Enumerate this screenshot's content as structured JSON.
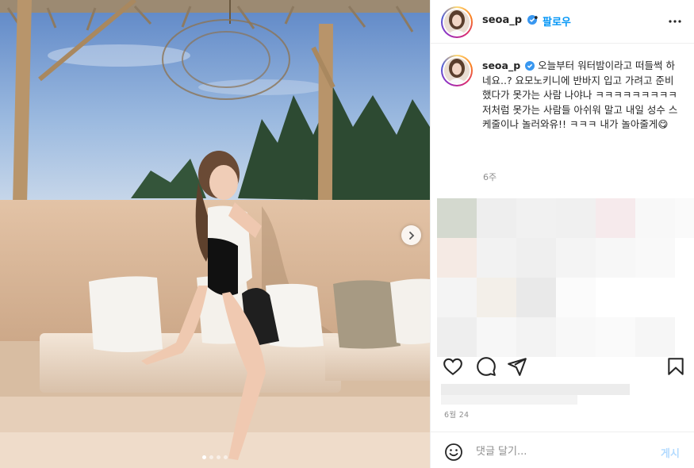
{
  "post": {
    "username": "seoa_p",
    "verified": true,
    "separator": "•",
    "follow_label": "팔로우",
    "caption_text": "오늘부터 워터밤이라고 떠들썩 하네요..? 요모노키니에 반바지 입고 가려고 준비했다가 못가는 사람 나야나 ㅋㅋㅋㅋㅋㅋㅋㅋㅋ 저처럼 못가는 사람들 아쉬워 말고 내일 성수 스케줄이나 놀러와유!! ㅋㅋㅋ 내가 놀아줄게😋",
    "age": "6주",
    "date": "6월 24",
    "carousel": {
      "total": 4,
      "current": 1
    }
  },
  "comment": {
    "placeholder": "댓글 달기...",
    "post_label": "게시"
  },
  "icons": {
    "verified": "verified-badge-icon",
    "more": "more-options-icon",
    "like": "heart-icon",
    "comment": "comment-icon",
    "share": "share-icon",
    "save": "bookmark-icon",
    "emoji": "emoji-icon",
    "next": "chevron-right-icon"
  },
  "colors": {
    "accent": "#0095f6",
    "verified": "#3897f0",
    "post_disabled": "#b3dbff",
    "text": "#262626",
    "muted": "#8e8e8e"
  }
}
